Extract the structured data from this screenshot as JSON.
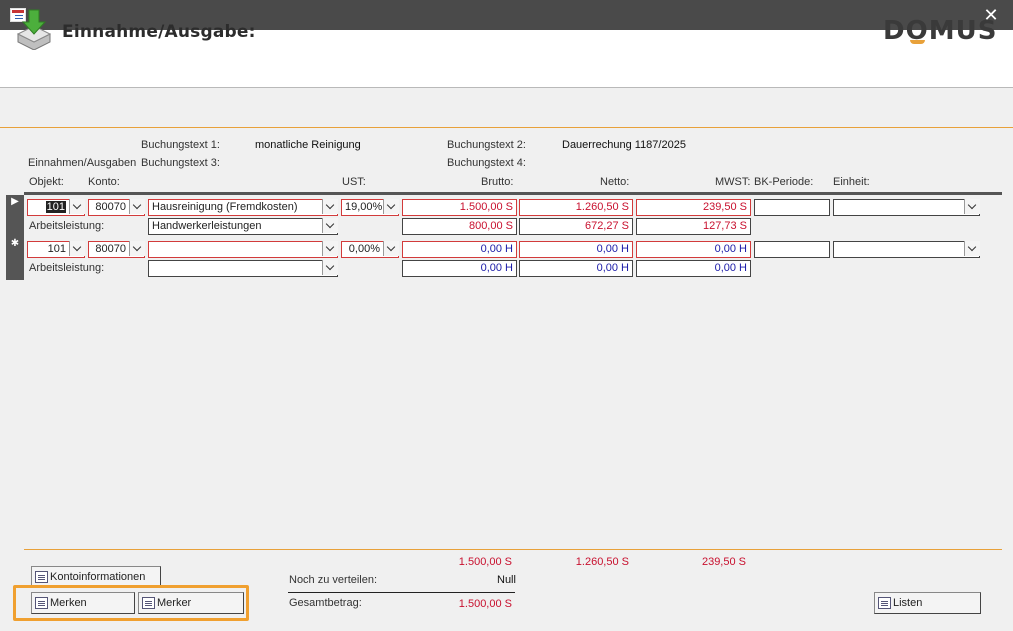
{
  "window": {
    "close_symbol": "✕"
  },
  "header": {
    "title": "Einnahme/Ausgabe:",
    "logo_pre": "D",
    "logo_o": "O",
    "logo_post": "MUS"
  },
  "booking": {
    "text1_label": "Buchungstext 1:",
    "text1_value": "monatliche Reinigung",
    "text2_label": "Buchungstext 2:",
    "text2_value": "Dauerrechung 1187/2025",
    "section_label": "Einnahmen/Ausgaben",
    "text3_label": "Buchungstext 3:",
    "text4_label": "Buchungstext 4:"
  },
  "columns": {
    "objekt": "Objekt:",
    "konto": "Konto:",
    "ust": "UST:",
    "brutto": "Brutto:",
    "netto": "Netto:",
    "mwst": "MWST:",
    "bk_periode": "BK-Periode:",
    "einheit": "Einheit:"
  },
  "rows": [
    {
      "selector": "▶",
      "objekt": "101",
      "konto": "80070",
      "account_name": "Hausreinigung (Fremdkosten)",
      "ust": "19,00%",
      "brutto": "1.500,00 S",
      "netto": "1.260,50 S",
      "mwst": "239,50 S",
      "bk_periode": "",
      "einheit": "",
      "labor_label": "Arbeitsleistung:",
      "labor_value": "Handwerkerleistungen",
      "labor_brutto": "800,00 S",
      "labor_netto": "672,27 S",
      "labor_mwst": "127,73 S"
    },
    {
      "selector": "✱",
      "objekt": "101",
      "konto": "80070",
      "account_name": "",
      "ust": "0,00%",
      "brutto": "0,00 H",
      "netto": "0,00 H",
      "mwst": "0,00 H",
      "bk_periode": "",
      "einheit": "",
      "labor_label": "Arbeitsleistung:",
      "labor_value": "",
      "labor_brutto": "0,00 H",
      "labor_netto": "0,00 H",
      "labor_mwst": "0,00 H"
    }
  ],
  "totals": {
    "brutto": "1.500,00 S",
    "netto": "1.260,50 S",
    "mwst": "239,50 S",
    "remaining_label": "Noch zu verteilen:",
    "remaining_value": "Null",
    "total_label": "Gesamtbetrag:",
    "total_value": "1.500,00 S"
  },
  "buttons": {
    "kontoinfo": "Kontoinformationen",
    "merken": "Merken",
    "merker": "Merker",
    "listen": "Listen"
  },
  "colors": {
    "accent": "#e8a13a",
    "negative": "#c8102e",
    "credit": "#1a1aa8"
  }
}
